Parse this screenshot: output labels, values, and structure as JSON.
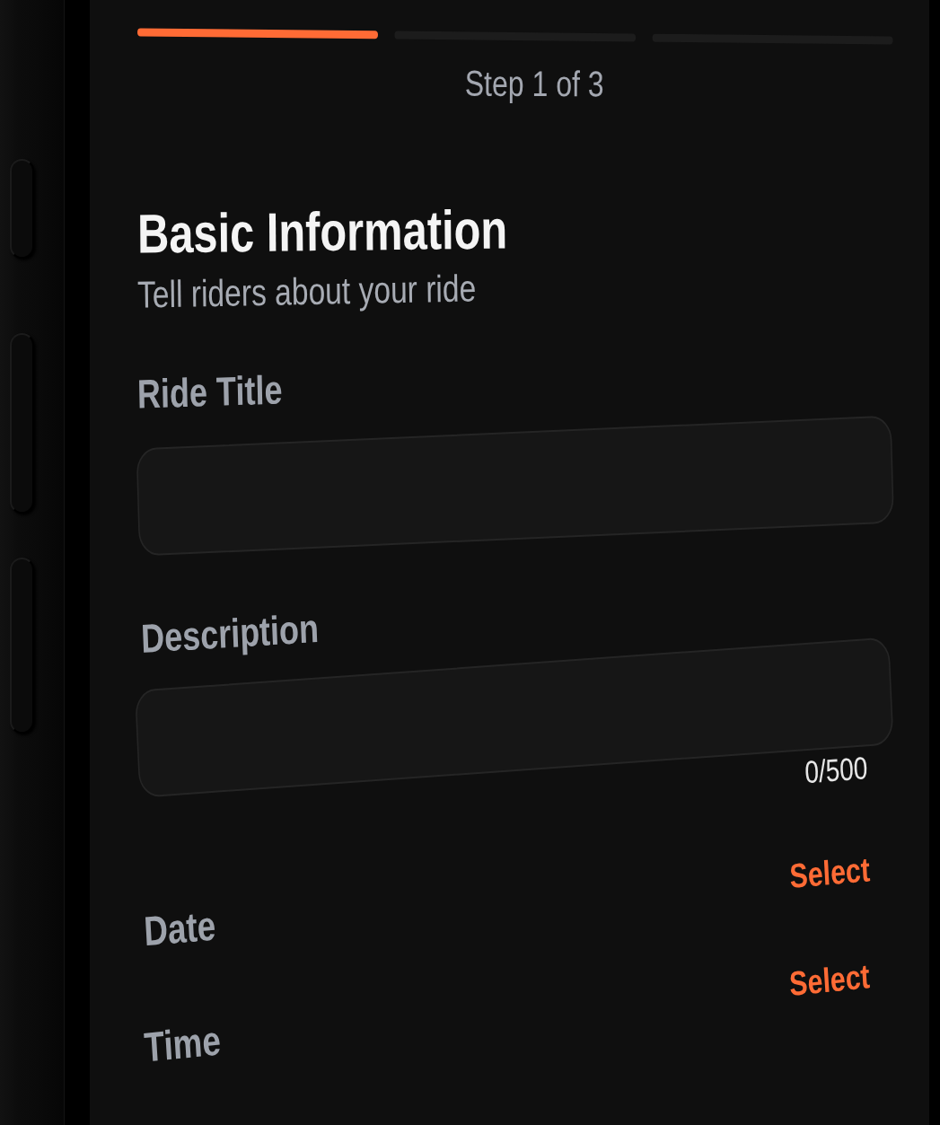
{
  "progress": {
    "steps": [
      {
        "complete": true
      },
      {
        "complete": false
      },
      {
        "complete": false
      }
    ],
    "label": "Step 1 of 3"
  },
  "header": {
    "title": "Basic Information",
    "subtitle": "Tell riders about your ride"
  },
  "fields": [
    {
      "label": "Ride Title"
    },
    {
      "label": "Description",
      "counter": "0/500"
    }
  ],
  "pickers": [
    {
      "label": "Date",
      "action": "Select"
    },
    {
      "label": "Time",
      "action": "Select"
    }
  ]
}
